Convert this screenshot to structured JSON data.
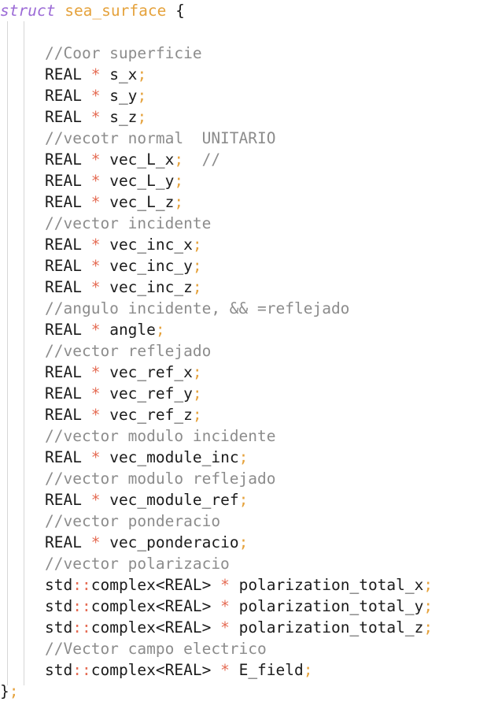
{
  "struct_keyword": "struct",
  "struct_name": "sea_surface",
  "open_brace": " {",
  "close_brace": "}",
  "close_semi": ";",
  "lines": [
    {
      "kind": "blank"
    },
    {
      "kind": "comment",
      "text": "//Coor superficie"
    },
    {
      "kind": "decl",
      "type": "REAL",
      "ptr": " * ",
      "name": "s_x"
    },
    {
      "kind": "decl",
      "type": "REAL",
      "ptr": " * ",
      "name": "s_y"
    },
    {
      "kind": "decl",
      "type": "REAL",
      "ptr": " * ",
      "name": "s_z"
    },
    {
      "kind": "comment",
      "text": "//vecotr normal  UNITARIO"
    },
    {
      "kind": "decl",
      "type": "REAL",
      "ptr": " * ",
      "name": "vec_L_x",
      "trail": "  //"
    },
    {
      "kind": "decl",
      "type": "REAL",
      "ptr": " * ",
      "name": "vec_L_y"
    },
    {
      "kind": "decl",
      "type": "REAL",
      "ptr": " * ",
      "name": "vec_L_z"
    },
    {
      "kind": "comment",
      "text": "//vector incidente"
    },
    {
      "kind": "decl",
      "type": "REAL",
      "ptr": " * ",
      "name": "vec_inc_x"
    },
    {
      "kind": "decl",
      "type": "REAL",
      "ptr": " * ",
      "name": "vec_inc_y"
    },
    {
      "kind": "decl",
      "type": "REAL",
      "ptr": " * ",
      "name": "vec_inc_z"
    },
    {
      "kind": "comment",
      "text": "//angulo incidente, && =reflejado"
    },
    {
      "kind": "decl",
      "type": "REAL",
      "ptr": " * ",
      "name": "angle"
    },
    {
      "kind": "comment",
      "text": "//vector reflejado"
    },
    {
      "kind": "decl",
      "type": "REAL",
      "ptr": " * ",
      "name": "vec_ref_x"
    },
    {
      "kind": "decl",
      "type": "REAL",
      "ptr": " * ",
      "name": "vec_ref_y"
    },
    {
      "kind": "decl",
      "type": "REAL",
      "ptr": " * ",
      "name": "vec_ref_z"
    },
    {
      "kind": "comment",
      "text": "//vector modulo incidente"
    },
    {
      "kind": "decl",
      "type": "REAL",
      "ptr": " * ",
      "name": "vec_module_inc"
    },
    {
      "kind": "comment",
      "text": "//vector modulo reflejado"
    },
    {
      "kind": "decl",
      "type": "REAL",
      "ptr": " * ",
      "name": "vec_module_ref"
    },
    {
      "kind": "comment",
      "text": "//vector ponderacio"
    },
    {
      "kind": "decl",
      "type": "REAL",
      "ptr": " * ",
      "name": "vec_ponderacio"
    },
    {
      "kind": "comment",
      "text": "//vector polarizacio"
    },
    {
      "kind": "cdecl",
      "ns": "std",
      "sep": "::",
      "type": "complex<REAL>",
      "ptr": " * ",
      "name": "polarization_total_x"
    },
    {
      "kind": "cdecl",
      "ns": "std",
      "sep": "::",
      "type": "complex<REAL>",
      "ptr": " * ",
      "name": "polarization_total_y"
    },
    {
      "kind": "cdecl",
      "ns": "std",
      "sep": "::",
      "type": "complex<REAL>",
      "ptr": " * ",
      "name": "polarization_total_z"
    },
    {
      "kind": "comment",
      "text": "//Vector campo electrico"
    },
    {
      "kind": "cdecl",
      "ns": "std",
      "sep": "::",
      "type": "complex<REAL>",
      "ptr": " * ",
      "name": "E_field"
    }
  ],
  "semicolon": ";",
  "colors": {
    "keyword": "#9b6ad6",
    "struct_name": "#e5a23c",
    "comment": "#8c8c8c",
    "operator": "#e56b53",
    "punct": "#e5a23c",
    "text": "#1b1b1b",
    "indent_guide": "#d6d6d6"
  }
}
